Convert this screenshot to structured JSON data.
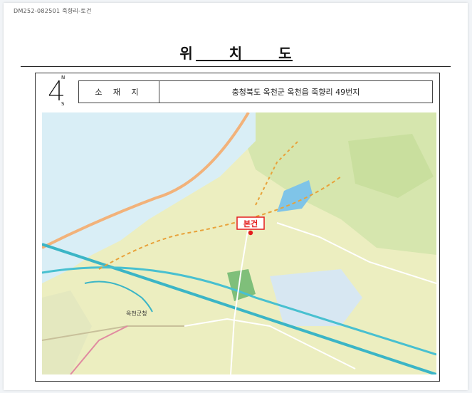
{
  "header": {
    "doc_code": "DM252-082501 죽향리-토건"
  },
  "title": "위 치 도",
  "compass": {
    "north": "N",
    "south": "S"
  },
  "location": {
    "label": "소 재 지",
    "value": "충청북도 옥천군 옥천읍 죽향리 49번지"
  },
  "map": {
    "marker_label": "본건",
    "place_label": "옥천군청",
    "colors": {
      "water": "#d8ecf5",
      "terrain": "#eceec0",
      "forest": "#cfe2a6",
      "road_major": "#f2a84a",
      "railway": "#3bb5c6",
      "marker": "#e41d1d"
    }
  }
}
